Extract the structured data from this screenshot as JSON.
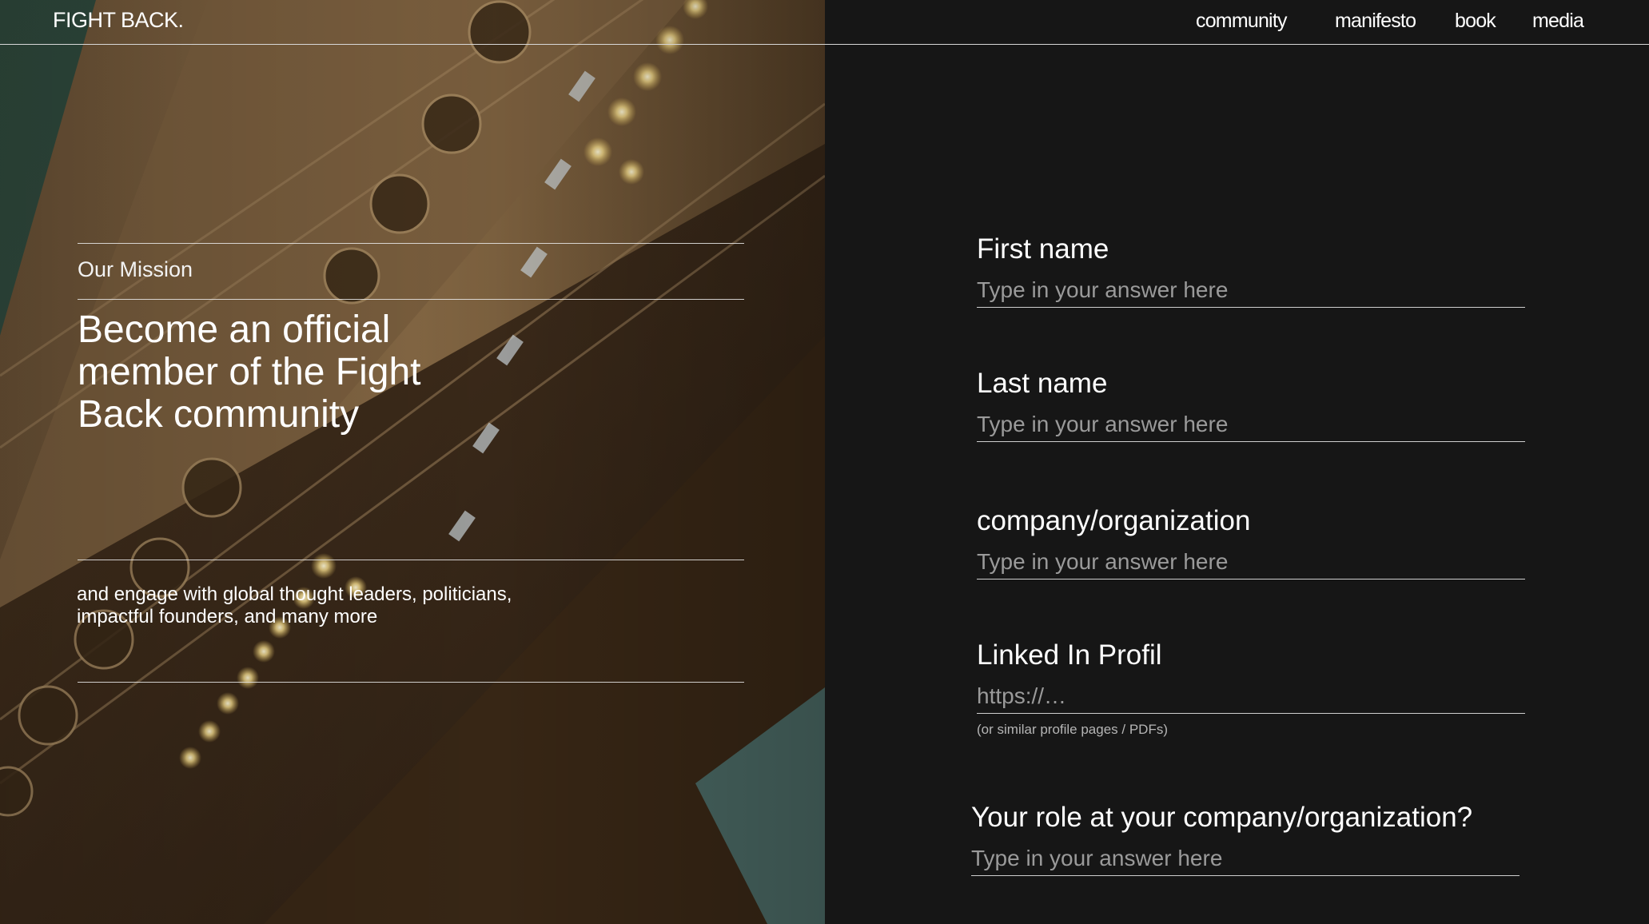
{
  "header": {
    "brand": "FIGHT BACK.",
    "nav": [
      "community",
      "manifesto",
      "book",
      "media"
    ]
  },
  "mission": {
    "label": "Our Mission",
    "title": "Become an official member of the Fight Back community",
    "subtitle": "and engage with global thought leaders, politicians, impactful founders, and many more"
  },
  "form": {
    "fields": [
      {
        "label": "First name",
        "placeholder": "Type in your answer here",
        "value": ""
      },
      {
        "label": "Last name",
        "placeholder": "Type in your answer here",
        "value": ""
      },
      {
        "label": "company/organization",
        "placeholder": "Type in your answer here",
        "value": ""
      },
      {
        "label": "Linked In Profil",
        "placeholder": "https://…",
        "value": "",
        "hint": "(or similar profile pages / PDFs)"
      },
      {
        "label": "Your role at your company/organization?",
        "placeholder": "Type in your answer here",
        "value": ""
      }
    ]
  },
  "colors": {
    "background": "#161616",
    "text": "#ffffff",
    "placeholder": "#9a9a9a",
    "rule": "#d8d8d8"
  }
}
